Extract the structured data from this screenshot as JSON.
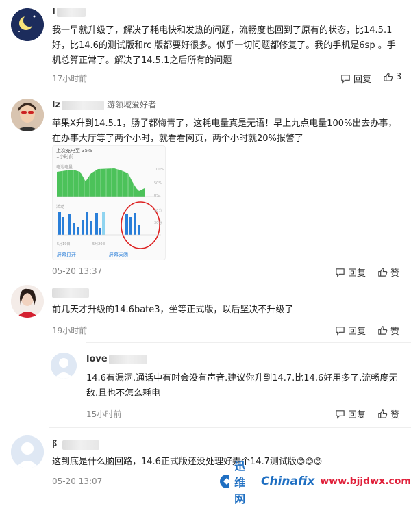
{
  "comments": [
    {
      "name": "I",
      "text": "我一早就升级了，解决了耗电快和发热的问题，流畅度也回到了原有的状态，比14.5.1好，比14.6的测试版和rc 版都要好很多。似乎一切问题都修复了。我的手机是6sp 。手机总算正常了。解决了14.5.1之后所有的问题",
      "time": "17小时前",
      "reply_label": "回复",
      "like_count": "3"
    },
    {
      "name": "lz",
      "name_suffix": "游领域爱好者",
      "text": "苹果X升到14.5.1，肠子都悔青了，这耗电量真是无语！早上九点电量100%出去办事，在办事大厅等了两个小时，就看看网页，两个小时就20%报警了",
      "time": "05-20 13:37",
      "reply_label": "回复",
      "like_label": "赞",
      "image": {
        "header": "上次充电至 35%",
        "subheader": "1小时前",
        "battery_label": "电池电量",
        "activity_label": "活动",
        "left_link": "屏幕打开",
        "right_link": "屏幕关闭",
        "date1": "5月19日",
        "date2": "5月20日"
      }
    },
    {
      "text": "前几天才升级的14.6bate3，坐等正式版，以后坚决不升级了",
      "time": "19小时前",
      "reply_label": "回复",
      "like_label": "赞"
    },
    {
      "name": "love",
      "text": "14.6有漏洞.通话中有时会没有声音.建议你升到14.7.比14.6好用多了.流畅度无敌.且也不怎么耗电",
      "time": "15小时前",
      "reply_label": "回复",
      "like_label": "赞"
    },
    {
      "name": "阝",
      "text": "这到底是什么脑回路，14.6正式版还没处理好弄个14.7测试版",
      "emojis": "😊😊😊",
      "time": "05-20 13:07"
    }
  ],
  "watermark": {
    "brand": "迅维网",
    "brand_en": "Chinafix",
    "url": "www.bjjdwx.com"
  },
  "colors": {
    "chart_green": "#4cc25a",
    "chart_blue": "#2a7fd9",
    "circle_red": "#d22",
    "link_blue": "#2a7fd9"
  }
}
